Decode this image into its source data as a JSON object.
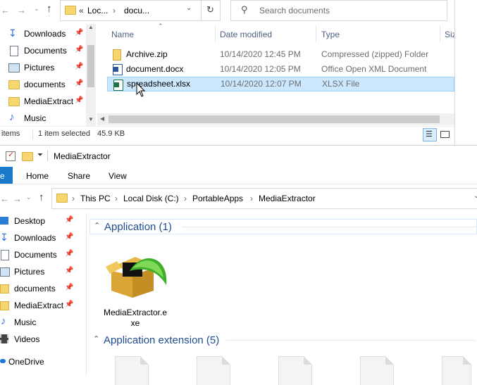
{
  "top": {
    "addr_seg1": "Loc...",
    "addr_seg2": "docu...",
    "search_placeholder": "Search documents",
    "columns": {
      "name": "Name",
      "date": "Date modified",
      "type": "Type",
      "size": "Siz"
    },
    "sidebar": [
      {
        "label": "Downloads"
      },
      {
        "label": "Documents"
      },
      {
        "label": "Pictures"
      },
      {
        "label": "documents"
      },
      {
        "label": "MediaExtract"
      },
      {
        "label": "Music"
      }
    ],
    "files": [
      {
        "name": "Archive.zip",
        "date": "10/14/2020 12:45 PM",
        "type": "Compressed (zipped) Folder"
      },
      {
        "name": "document.docx",
        "date": "10/14/2020 12:05 PM",
        "type": "Office Open XML Document"
      },
      {
        "name": "spreadsheet.xlsx",
        "date": "10/14/2020 12:07 PM",
        "type": "XLSX File"
      }
    ],
    "status": {
      "items": "items",
      "selected": "1 item selected",
      "size": "45.9 KB"
    }
  },
  "bottom": {
    "title": "MediaExtractor",
    "ribbon": {
      "file": "e",
      "home": "Home",
      "share": "Share",
      "view": "View"
    },
    "breadcrumb": [
      "This PC",
      "Local Disk (C:)",
      "PortableApps",
      "MediaExtractor"
    ],
    "sidebar": [
      {
        "label": "Desktop"
      },
      {
        "label": "Downloads"
      },
      {
        "label": "Documents"
      },
      {
        "label": "Pictures"
      },
      {
        "label": "documents"
      },
      {
        "label": "MediaExtract"
      },
      {
        "label": "Music"
      },
      {
        "label": "Videos"
      },
      {
        "label": "OneDrive"
      }
    ],
    "group1": "Application (1)",
    "app_name": "MediaExtractor.e\nxe",
    "group2": "Application extension (5)"
  },
  "colors": {
    "accent": "#1e4e90",
    "selection": "#cce8ff",
    "folder": "#f7d672"
  }
}
